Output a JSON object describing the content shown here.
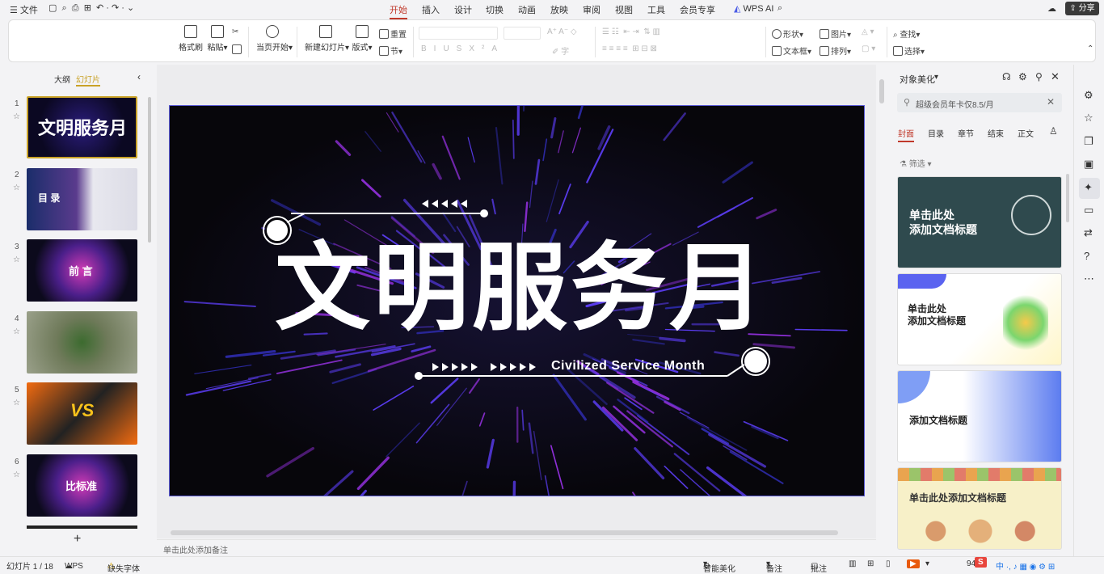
{
  "menu": {
    "file_label": "文件",
    "tabs": [
      "开始",
      "插入",
      "设计",
      "切换",
      "动画",
      "放映",
      "审阅",
      "视图",
      "工具",
      "会员专享"
    ],
    "wps_ai": "WPS AI",
    "share_label": "分享"
  },
  "ribbon": {
    "format_painter": "格式刷",
    "paste": "粘贴",
    "play_from_current": "当页开始",
    "new_slide": "新建幻灯片",
    "layout": "版式",
    "section": "节",
    "reset": "重置",
    "shape": "形状",
    "picture": "图片",
    "textbox": "文本框",
    "arrange": "排列",
    "find": "查找",
    "select": "选择"
  },
  "left_panel": {
    "tab_outline": "大纲",
    "tab_slides": "幻灯片",
    "slides": [
      {
        "number": "1",
        "title": "文明服务月"
      },
      {
        "number": "2",
        "title": "目 录"
      },
      {
        "number": "3",
        "title": "前 言"
      },
      {
        "number": "4",
        "title": ""
      },
      {
        "number": "5",
        "title": "VS"
      },
      {
        "number": "6",
        "title": "比标准"
      }
    ],
    "add_label": "+"
  },
  "slide": {
    "title": "文明服务月",
    "subtitle": "Civilized Service Month"
  },
  "notes_placeholder": "单击此处添加备注",
  "right_panel": {
    "title": "对象美化",
    "promo": "超级会员年卡仅8.5/月",
    "tabs": [
      "封面",
      "目录",
      "章节",
      "结束",
      "正文"
    ],
    "filter": "筛选",
    "cards": [
      {
        "text": "单击此处\n添加文档标题"
      },
      {
        "text": "单击此处\n添加文档标题"
      },
      {
        "text": "添加文档标题"
      },
      {
        "text": "单击此处添加文档标题"
      }
    ]
  },
  "status": {
    "slide_count": "幻灯片 1 / 18",
    "app": "WPS",
    "missing_font": "缺失字体",
    "smart_beautify": "智能美化",
    "notes": "备注",
    "comments": "批注",
    "zoom": "94"
  },
  "colors": {
    "accent": "#c0392b",
    "slide_bg": "#07060b",
    "streak": "#5a3cf0"
  }
}
